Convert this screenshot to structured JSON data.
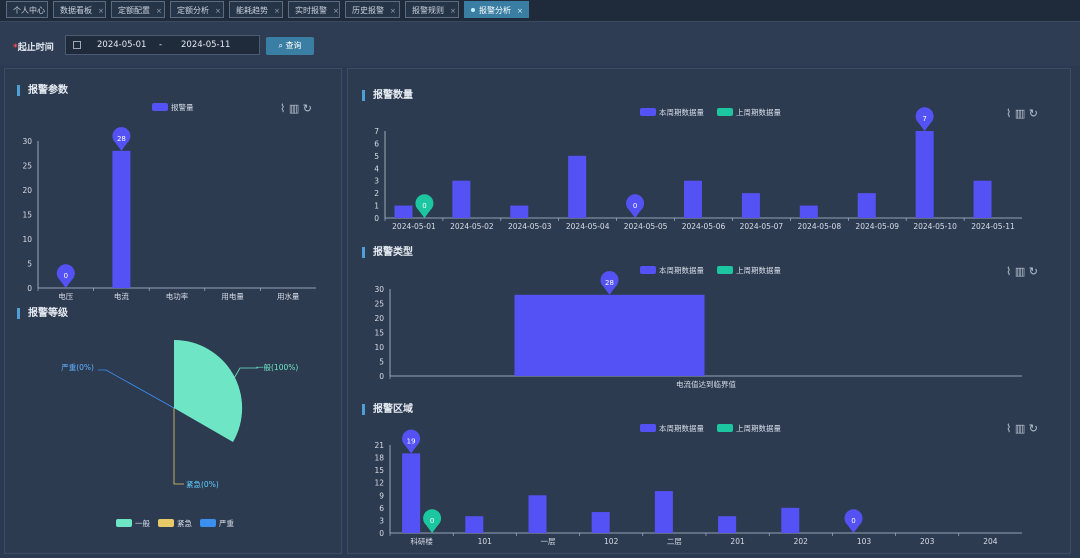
{
  "tabs": [
    {
      "label": "个人中心",
      "active": false,
      "closable": false
    },
    {
      "label": "数据看板",
      "active": false,
      "closable": true
    },
    {
      "label": "定额配置",
      "active": false,
      "closable": true
    },
    {
      "label": "定额分析",
      "active": false,
      "closable": true
    },
    {
      "label": "能耗趋势",
      "active": false,
      "closable": true
    },
    {
      "label": "实时报警",
      "active": false,
      "closable": true
    },
    {
      "label": "历史报警",
      "active": false,
      "closable": true
    },
    {
      "label": "报警规则",
      "active": false,
      "closable": true
    },
    {
      "label": "报警分析",
      "active": true,
      "closable": true
    }
  ],
  "query": {
    "label": "起止时间",
    "start": "2024-05-01",
    "sep": "-",
    "end": "2024-05-11",
    "button": "查询"
  },
  "colors": {
    "current": "#5552f5",
    "previous": "#1cc6a0",
    "pie_normal": "#6ee6c6",
    "pie_urgent": "#e8c96a",
    "pie_severe": "#3b8ff0"
  },
  "panels": {
    "params": {
      "title": "报警参数"
    },
    "level": {
      "title": "报警等级"
    },
    "count": {
      "title": "报警数量"
    },
    "type": {
      "title": "报警类型"
    },
    "area": {
      "title": "报警区域"
    }
  },
  "chart_data": [
    {
      "id": "params",
      "type": "bar",
      "title": "报警参数",
      "series": [
        {
          "name": "报警量",
          "values": [
            0,
            28,
            null,
            null,
            null
          ]
        }
      ],
      "categories": [
        "电压",
        "电流",
        "电功率",
        "用电量",
        "用水量"
      ],
      "ylim": [
        0,
        30
      ],
      "yticks": [
        0,
        5,
        10,
        15,
        20,
        25,
        30
      ],
      "markers": [
        {
          "cat": 0,
          "value": 0,
          "label": "0"
        },
        {
          "cat": 1,
          "value": 28,
          "label": "28"
        }
      ]
    },
    {
      "id": "level",
      "type": "pie",
      "title": "报警等级",
      "slices": [
        {
          "name": "一般",
          "value": 100,
          "label": "一般(100%)"
        },
        {
          "name": "紧急",
          "value": 0,
          "label": "紧急(0%)"
        },
        {
          "name": "严重",
          "value": 0,
          "label": "严重(0%)"
        }
      ],
      "legend": [
        "一般",
        "紧急",
        "严重"
      ]
    },
    {
      "id": "count",
      "type": "bar",
      "title": "报警数量",
      "categories": [
        "2024-05-01",
        "2024-05-02",
        "2024-05-03",
        "2024-05-04",
        "2024-05-05",
        "2024-05-06",
        "2024-05-07",
        "2024-05-08",
        "2024-05-09",
        "2024-05-10",
        "2024-05-11"
      ],
      "series": [
        {
          "name": "本周期数据量",
          "values": [
            1,
            3,
            1,
            5,
            0,
            3,
            2,
            1,
            2,
            7,
            3
          ]
        },
        {
          "name": "上周期数据量",
          "values": [
            0,
            null,
            null,
            null,
            null,
            null,
            null,
            null,
            null,
            null,
            null
          ]
        }
      ],
      "ylim": [
        0,
        7
      ],
      "yticks": [
        0,
        1,
        2,
        3,
        4,
        5,
        6,
        7
      ],
      "markers": [
        {
          "cat": 0,
          "series": 1,
          "value": 0,
          "label": "0"
        },
        {
          "cat": 4,
          "series": 0,
          "value": 0,
          "label": "0"
        },
        {
          "cat": 9,
          "series": 0,
          "value": 7,
          "label": "7"
        }
      ]
    },
    {
      "id": "type",
      "type": "bar",
      "title": "报警类型",
      "categories": [
        "电流值达到临界值"
      ],
      "series": [
        {
          "name": "本周期数据量",
          "values": [
            28
          ]
        },
        {
          "name": "上周期数据量",
          "values": [
            null
          ]
        }
      ],
      "ylim": [
        0,
        30
      ],
      "yticks": [
        0,
        5,
        10,
        15,
        20,
        25,
        30
      ],
      "markers": [
        {
          "cat": 0,
          "series": 0,
          "value": 28,
          "label": "28"
        }
      ]
    },
    {
      "id": "area",
      "type": "bar",
      "title": "报警区域",
      "categories": [
        "科研楼",
        "101",
        "一层",
        "102",
        "二层",
        "201",
        "202",
        "103",
        "203",
        "204"
      ],
      "series": [
        {
          "name": "本周期数据量",
          "values": [
            19,
            4,
            9,
            5,
            10,
            4,
            6,
            0,
            null,
            null
          ]
        },
        {
          "name": "上周期数据量",
          "values": [
            0,
            null,
            null,
            null,
            null,
            null,
            null,
            null,
            null,
            null
          ]
        }
      ],
      "ylim": [
        0,
        21
      ],
      "yticks": [
        0,
        3,
        6,
        9,
        12,
        15,
        18,
        21
      ],
      "markers": [
        {
          "cat": 0,
          "series": 0,
          "value": 19,
          "label": "19"
        },
        {
          "cat": 0,
          "series": 1,
          "value": 0,
          "label": "0"
        },
        {
          "cat": 7,
          "series": 0,
          "value": 0,
          "label": "0"
        }
      ]
    }
  ]
}
